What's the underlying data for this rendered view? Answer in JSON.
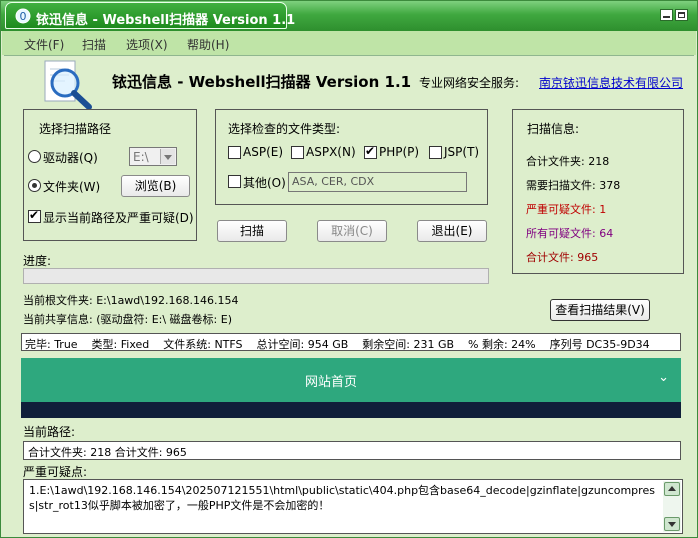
{
  "window": {
    "title": "铱迅信息 - Webshell扫描器 Version 1.1"
  },
  "menu": [
    "文件(F)",
    "扫描",
    "选项(X)",
    "帮助(H)"
  ],
  "header": {
    "product": "铱迅信息 - Webshell扫描器 Version 1.1",
    "service_label": "专业网络安全服务:",
    "company_link": "南京铱迅信息技术有限公司"
  },
  "path_group": {
    "title": "选择扫描路径",
    "drive_label": "驱动器(Q)",
    "drive_value": "E:\\",
    "folder_label": "文件夹(W)",
    "browse_button": "浏览(B)",
    "show_current_label": "显示当前路径及严重可疑(D)"
  },
  "filetype_group": {
    "title": "选择检查的文件类型:",
    "asp": "ASP(E)",
    "aspx": "ASPX(N)",
    "php": "PHP(P)",
    "jsp": "JSP(T)",
    "other": "其他(O)",
    "other_value": "ASA, CER, CDX"
  },
  "buttons": {
    "scan": "扫描",
    "cancel": "取消(C)",
    "exit": "退出(E)",
    "view_results": "查看扫描结果(V)"
  },
  "scan_info": {
    "title": "扫描信息:",
    "total_folders": "合计文件夹: 218",
    "need_scan": "需要扫描文件: 378",
    "serious": "严重可疑文件: 1",
    "all_suspicious": "所有可疑文件: 64",
    "total_files": "合计文件: 965"
  },
  "progress": {
    "label": "进度:",
    "value": 0
  },
  "current": {
    "root_folder": "当前根文件夹: E:\\1awd\\192.168.146.154",
    "share_info": "当前共享信息: (驱动盘符: E:\\   磁盘卷标: E)"
  },
  "disk_info": "完毕: True    类型: Fixed    文件系统: NTFS    总计空间: 954 GB    剩余空间: 231 GB    % 剩余: 24%    序列号 DC35-9D34",
  "website_banner": "网站首页",
  "current_path": {
    "label": "当前路径:",
    "value": "合计文件夹: 218 合计文件: 965"
  },
  "suspicious": {
    "label": "严重可疑点:",
    "text": "1.E:\\1awd\\192.168.146.154\\202507121551\\html\\public\\static\\404.php包含base64_decode|gzinflate|gzuncompress|str_rot13似乎脚本被加密了，一般PHP文件是不会加密的！"
  },
  "colors": {
    "title_green": "#2e8f2e",
    "serious_red": "#c00000",
    "suspicious_purple": "#800080",
    "total_red": "#a00000",
    "banner_teal": "#2ea87e",
    "link_blue": "#0000cc"
  }
}
